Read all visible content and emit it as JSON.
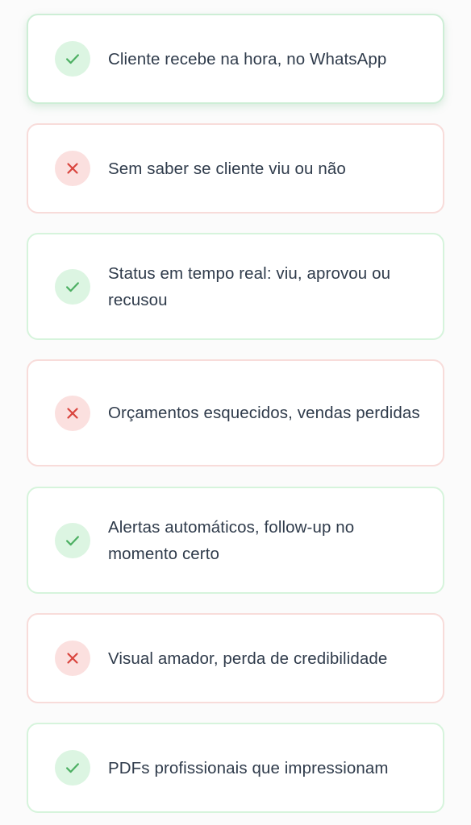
{
  "colors": {
    "pro_icon": "#4caf62",
    "pro_bg": "#dcf5e2",
    "con_icon": "#d9443d",
    "con_bg": "#fbe0df",
    "text": "#2f3b4b"
  },
  "items": [
    {
      "type": "pro",
      "icon": "check-icon",
      "label": "Cliente recebe na hora, no WhatsApp"
    },
    {
      "type": "con",
      "icon": "close-icon",
      "label": "Sem saber se cliente viu ou não"
    },
    {
      "type": "pro",
      "icon": "check-icon",
      "label": "Status em tempo real: viu, aprovou ou recusou"
    },
    {
      "type": "con",
      "icon": "close-icon",
      "label": "Orçamentos esquecidos, vendas perdidas"
    },
    {
      "type": "pro",
      "icon": "check-icon",
      "label": "Alertas automáticos, follow-up no momento certo"
    },
    {
      "type": "con",
      "icon": "close-icon",
      "label": "Visual amador, perda de credibilidade"
    },
    {
      "type": "pro",
      "icon": "check-icon",
      "label": "PDFs profissionais que impressionam"
    }
  ]
}
